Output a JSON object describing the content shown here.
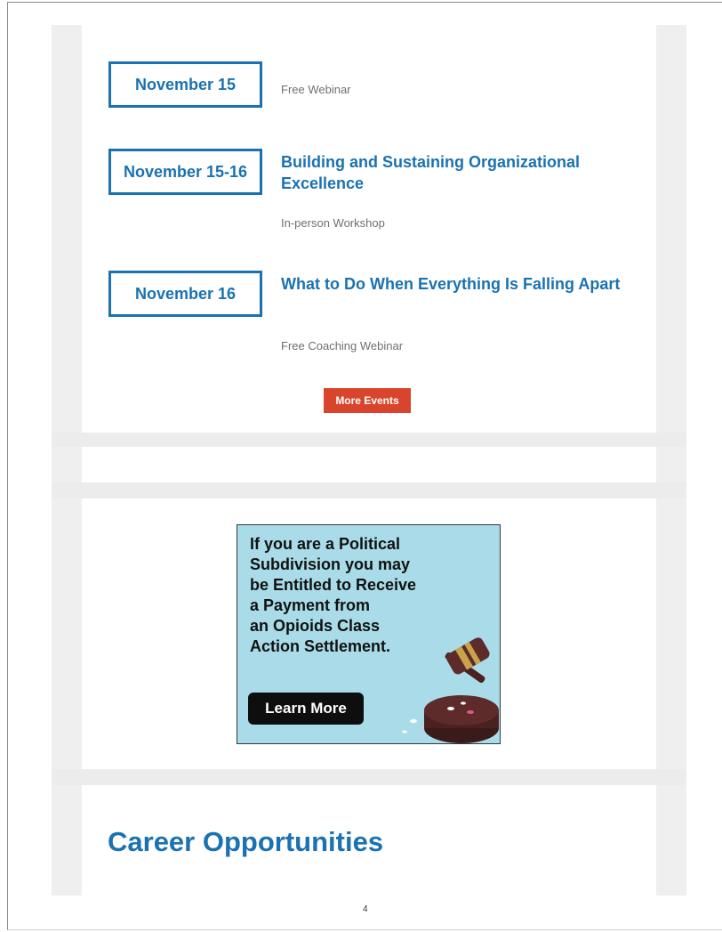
{
  "events": [
    {
      "date": "November 15",
      "title": "",
      "type": "Free Webinar"
    },
    {
      "date": "November 15-16",
      "title": "Building and Sustaining Organizational Excellence",
      "type": "In-person Workshop"
    },
    {
      "date": "November 16",
      "title": "What to Do When Everything Is Falling Apart",
      "type": "Free Coaching Webinar"
    }
  ],
  "more_events_label": "More Events",
  "ad": {
    "text": "If you are a Political\nSubdivision you may\nbe Entitled to Receive\na Payment from\nan Opioids Class\nAction Settlement.",
    "button_label": "Learn More",
    "image_icon": "gavel-pills-icon"
  },
  "career": {
    "title": "Career Opportunities"
  },
  "page_number": "4",
  "colors": {
    "accent": "#1a72b1",
    "button": "#d9452c",
    "ad_bg": "#a9dce8"
  }
}
